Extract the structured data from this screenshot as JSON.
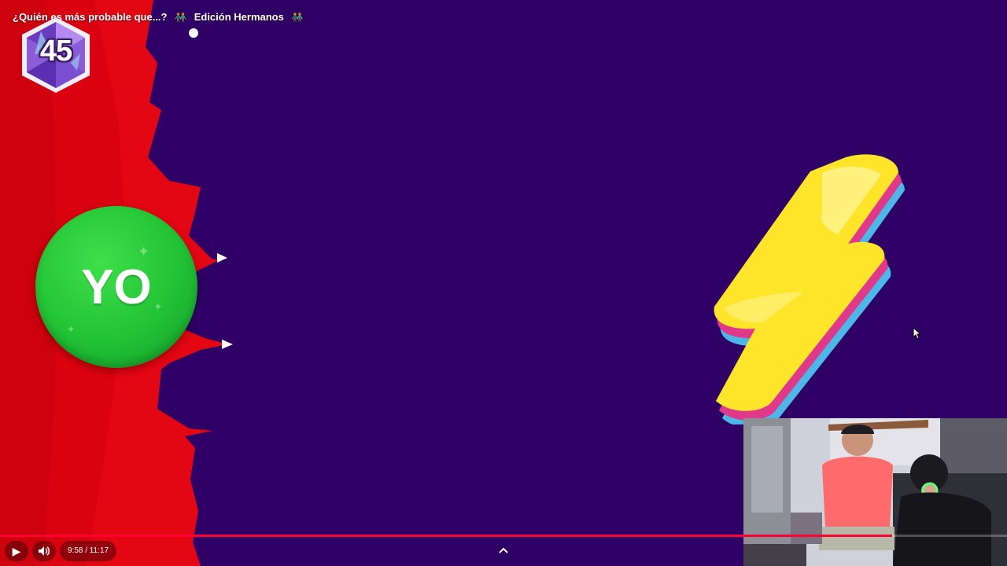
{
  "video": {
    "title_part1": "¿Quién es más probable que...?",
    "title_people_icon": "people-icon",
    "title_part2": "Edición Hermanos",
    "title_people_icon2": "people-icon",
    "badge_number": "45",
    "answer_label": "YO",
    "time_display": "9:58 / 11:17",
    "progress_fraction": 0.886
  },
  "colors": {
    "background": "#2f0066",
    "red_panel": "#e30613",
    "green_circle": "#21c235",
    "bolt_yellow": "#ffe52a",
    "progress": "#ff0033"
  },
  "controls": {
    "play_icon": "play-icon",
    "volume_icon": "volume-icon",
    "expand_icon": "chevron-up-icon"
  }
}
